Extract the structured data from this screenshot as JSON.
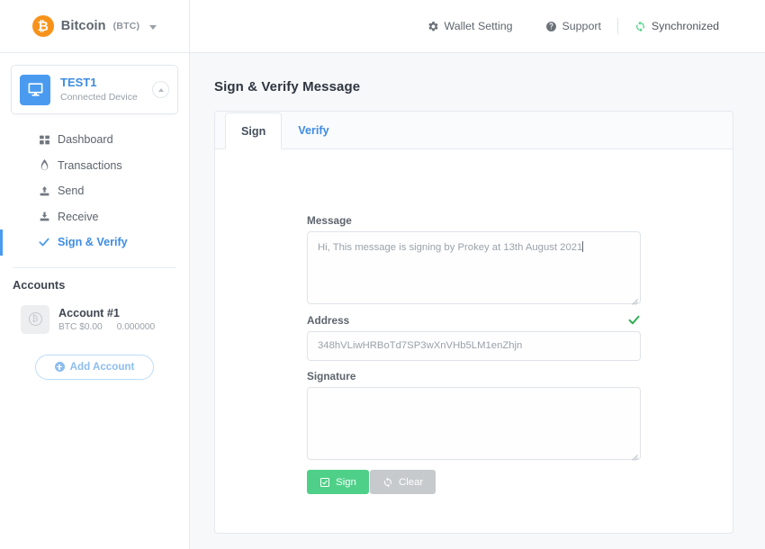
{
  "header": {
    "coin_name": "Bitcoin",
    "coin_ticker": "(BTC)",
    "coin_symbol": "₿",
    "wallet_setting": "Wallet Setting",
    "support": "Support",
    "sync_status": "Synchronized"
  },
  "sidebar": {
    "device": {
      "name": "TEST1",
      "status": "Connected Device"
    },
    "nav": [
      {
        "label": "Dashboard",
        "icon": "grid-icon",
        "active": false
      },
      {
        "label": "Transactions",
        "icon": "flame-icon",
        "active": false
      },
      {
        "label": "Send",
        "icon": "upload-icon",
        "active": false
      },
      {
        "label": "Receive",
        "icon": "download-icon",
        "active": false
      },
      {
        "label": "Sign & Verify",
        "icon": "check-icon",
        "active": true
      }
    ],
    "accounts_title": "Accounts",
    "accounts": [
      {
        "name": "Account #1",
        "fiat_label": "BTC $0.00",
        "amount": "0.000000"
      }
    ],
    "add_account": "Add Account"
  },
  "main": {
    "page_title": "Sign & Verify Message",
    "tabs": [
      {
        "label": "Sign",
        "active": true
      },
      {
        "label": "Verify",
        "active": false
      }
    ],
    "form": {
      "message_label": "Message",
      "message_value": "Hi, This message is signing by Prokey at 13th August 2021",
      "message_placeholder": "",
      "address_label": "Address",
      "address_value": "348hVLiwHRBoTd7SP3wXnVHb5LM1enZhjn",
      "address_valid": true,
      "signature_label": "Signature",
      "signature_value": "",
      "signature_placeholder": "",
      "sign_button": "Sign",
      "clear_button": "Clear"
    }
  },
  "colors": {
    "brand_orange": "#f7931a",
    "accent_blue": "#3d8ce4",
    "device_blue": "#4a9bf0",
    "success_green": "#4fd088",
    "check_green": "#2fae52",
    "clear_gray": "#c6cacd",
    "page_bg": "#f6f8fa"
  }
}
